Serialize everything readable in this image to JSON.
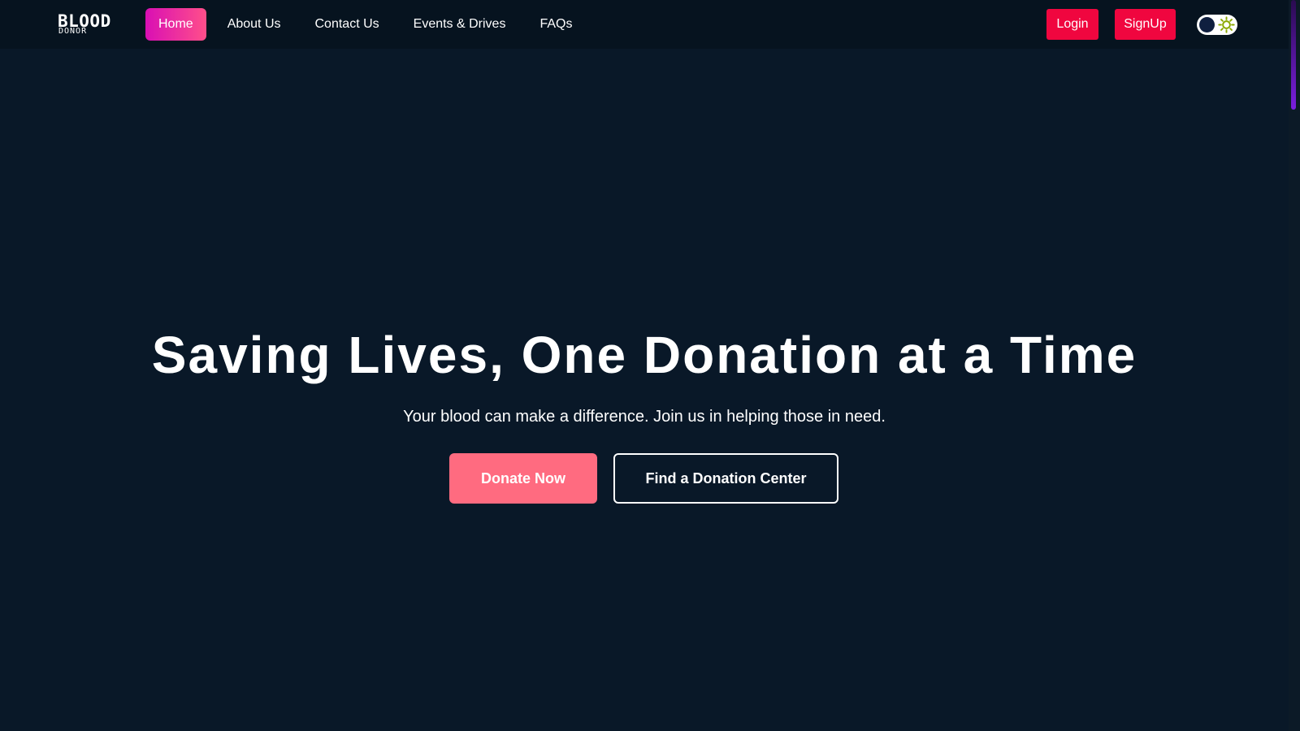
{
  "brand": {
    "name": "BLOOD",
    "subtitle": "DONOR"
  },
  "nav": {
    "items": [
      {
        "label": "Home",
        "active": true
      },
      {
        "label": "About Us",
        "active": false
      },
      {
        "label": "Contact Us",
        "active": false
      },
      {
        "label": "Events & Drives",
        "active": false
      },
      {
        "label": "FAQs",
        "active": false
      }
    ],
    "login_label": "Login",
    "signup_label": "SignUp",
    "theme_toggle_icon": "sun-icon"
  },
  "hero": {
    "title": "Saving Lives, One Donation at a Time",
    "subtitle": "Your blood can make a difference. Join us in helping those in need.",
    "primary_button": "Donate Now",
    "secondary_button": "Find a Donation Center"
  },
  "colors": {
    "background": "#091828",
    "navbar": "#06131f",
    "accent": "#f0063f",
    "donate_button": "#ff6b80",
    "active_nav_gradient_start": "#d90fb4",
    "active_nav_gradient_end": "#ff4f8a"
  }
}
